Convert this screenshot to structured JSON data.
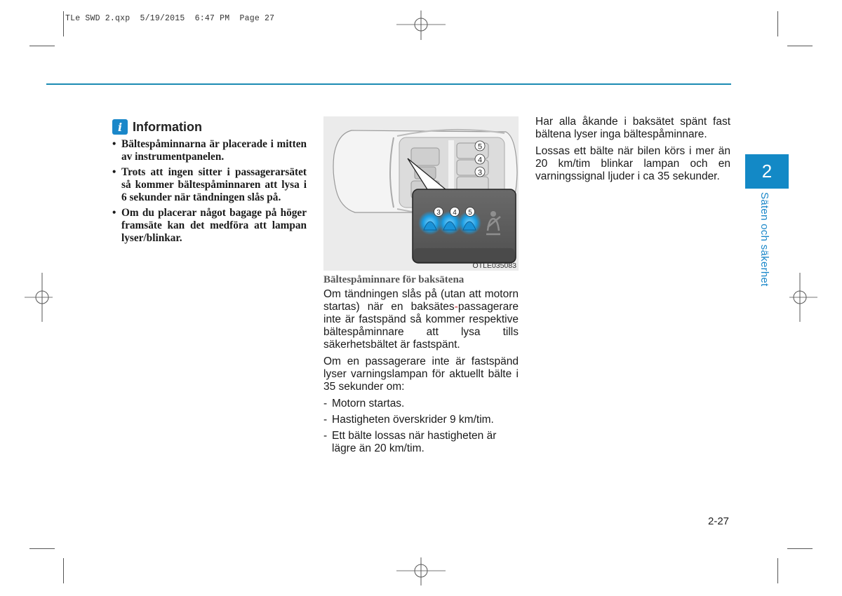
{
  "print_slug": "TLe SWD 2.qxp  5/19/2015  6:47 PM  Page 27",
  "colors": {
    "accent_blue": "#1389c6",
    "rule_blue": "#1b8bb3",
    "hyphen_red": "#d2232a",
    "lamp_glow": "#28a8e8"
  },
  "information": {
    "icon": "info-icon",
    "icon_glyph": "i",
    "title": "Information",
    "bullets": [
      "Bältespåminnarna är placerade i mitten av instrumentpanelen.",
      "Trots att ingen sitter i passagerarsätet så kommer bältespåminnaren att lysa i 6 sekunder när tändningen slås på.",
      "Om du placerar något bagage på höger framsäte kan det medföra att lampan lyser/blinkar."
    ]
  },
  "figure": {
    "seat_labels": [
      "5",
      "4",
      "3"
    ],
    "lamp_labels": [
      "3",
      "4",
      "5"
    ],
    "code": "OTLE035083"
  },
  "middle": {
    "subheading": "Bältespåminnare för baksätena",
    "para1_a": "Om tändningen slås på (utan att motorn startas) när en baksätes",
    "para1_hyphen": "-",
    "para1_b": "passagerare inte är fastspänd så kommer respektive bältespåminnare att lysa tills säkerhetsbältet är fastspänt.",
    "para2": "Om en passagerare inte är fastspänd lyser varningslampan för aktuellt bälte i 35 sekunder om:",
    "conditions": [
      "Motorn startas.",
      "Hastigheten överskrider 9 km/tim.",
      "Ett bälte lossas när hastigheten är lägre än 20 km/tim."
    ]
  },
  "right": {
    "para1": "Har alla åkande i baksätet spänt fast bältena lyser inga bältespåminnare.",
    "para2": "Lossas ett bälte när bilen körs i mer än 20 km/tim blinkar lampan och en varningssignal ljuder i ca 35 sekunder."
  },
  "chapter": {
    "number": "2",
    "title": "Säten och säkerhet"
  },
  "page_number": "2-27"
}
